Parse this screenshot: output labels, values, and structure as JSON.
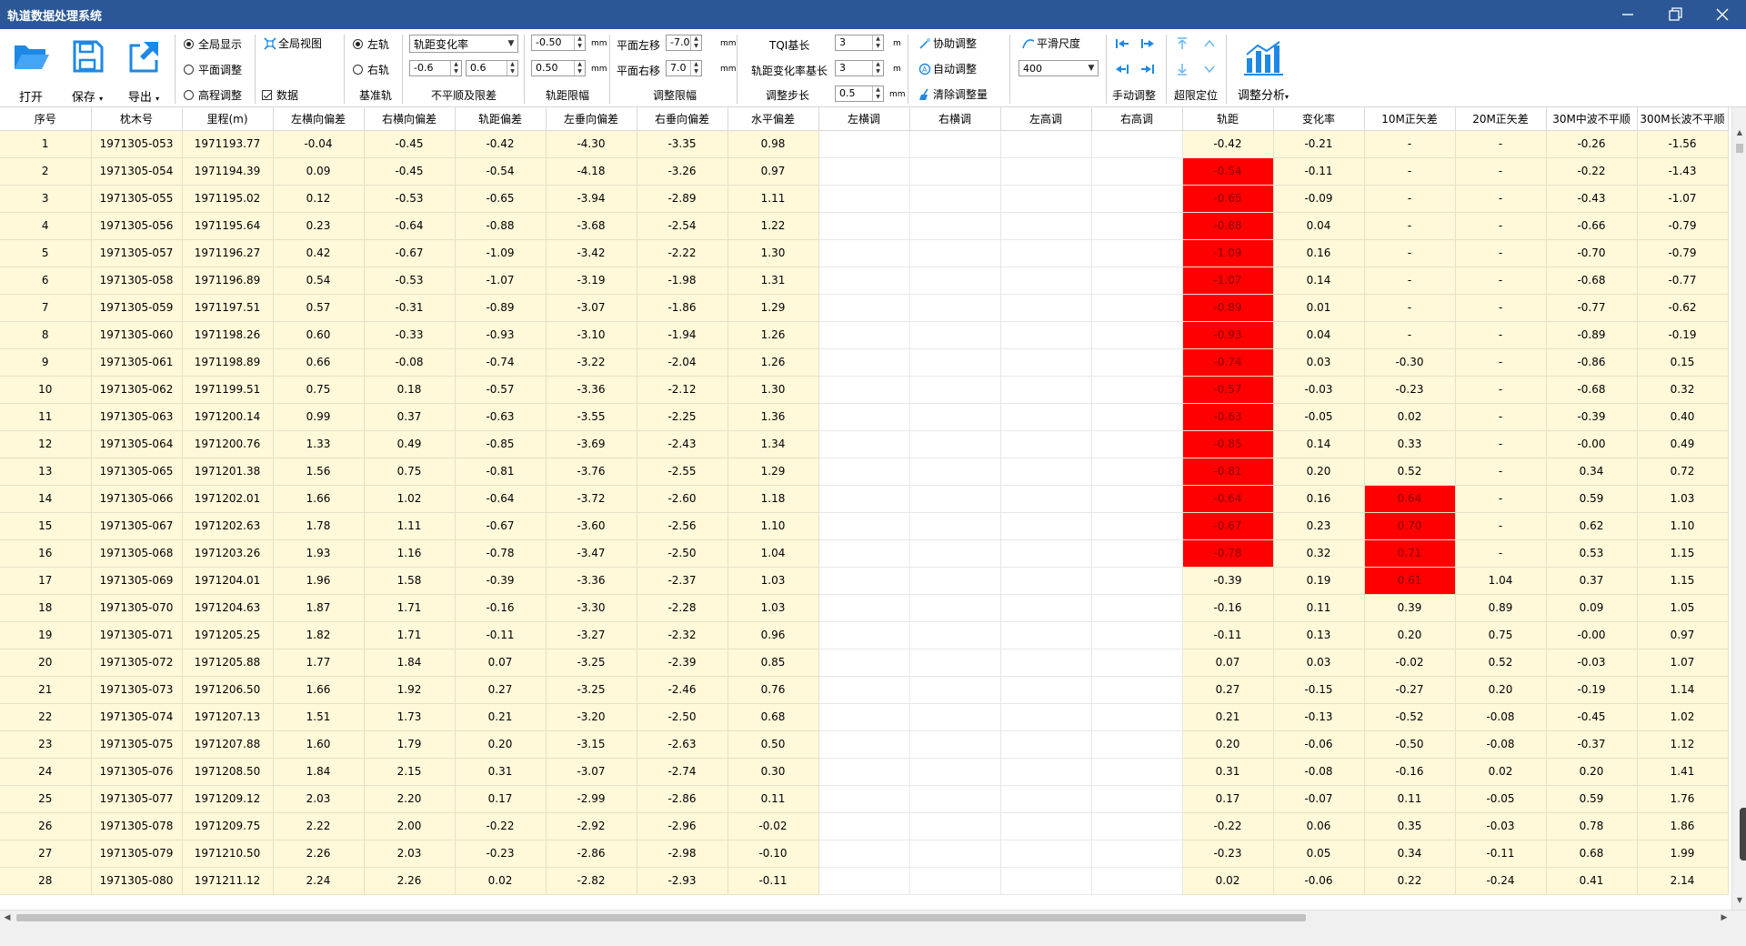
{
  "window": {
    "title": "轨道数据处理系统"
  },
  "toolbar": {
    "open_label": "打开",
    "save_label": "保存",
    "export_label": "导出",
    "display": {
      "full_display": "全局显示",
      "plane_adjust": "平面调整",
      "elevation_adjust": "高程调整",
      "global_view": "全局视图",
      "data": "数据"
    },
    "base_rail": {
      "left": "左轨",
      "right": "右轨",
      "group": "基准轨"
    },
    "unevenness": {
      "combo_value": "轨距变化率",
      "min": "-0.6",
      "max": "0.6",
      "group": "不平顺及限差"
    },
    "gauge_limit": {
      "min": "-0.50",
      "max": "0.50",
      "unit": "mm",
      "group": "轨距限幅"
    },
    "adjust_limit": {
      "left_label": "平面左移",
      "left_value": "-7.0",
      "right_label": "平面右移",
      "right_value": "7.0",
      "unit": "mm",
      "group": "调整限幅"
    },
    "tqi": {
      "base_label": "TQI基长",
      "base_value": "3",
      "base_unit": "m",
      "rate_label": "轨距变化率基长",
      "rate_value": "3",
      "rate_unit": "m",
      "step_label": "调整步长",
      "step_value": "0.5",
      "step_unit": "mm"
    },
    "assist": {
      "assist_adjust": "协助调整",
      "auto_adjust": "自动调整",
      "clear_adjust": "清除调整量"
    },
    "smooth": {
      "label": "平滑尺度",
      "value": "400"
    },
    "manual_group": "手动调整",
    "limit_group": "超限定位",
    "analysis_label": "调整分析"
  },
  "table": {
    "columns": [
      "序号",
      "枕木号",
      "里程(m)",
      "左横向偏差",
      "右横向偏差",
      "轨距偏差",
      "左垂向偏差",
      "右垂向偏差",
      "水平偏差",
      "左横调",
      "右横调",
      "左高调",
      "右高调",
      "轨距",
      "变化率",
      "10M正矢差",
      "20M正矢差",
      "30M中波不平顺",
      "300M长波不平顺"
    ],
    "rows": [
      [
        "1",
        "1971305-053",
        "1971193.77",
        "-0.04",
        "-0.45",
        "-0.42",
        "-4.30",
        "-3.35",
        "0.98",
        "",
        "",
        "",
        "",
        "-0.42",
        "-0.21",
        "-",
        "-",
        "-0.26",
        "-1.56"
      ],
      [
        "2",
        "1971305-054",
        "1971194.39",
        "0.09",
        "-0.45",
        "-0.54",
        "-4.18",
        "-3.26",
        "0.97",
        "",
        "",
        "",
        "",
        "-0.54",
        "-0.11",
        "-",
        "-",
        "-0.22",
        "-1.43"
      ],
      [
        "3",
        "1971305-055",
        "1971195.02",
        "0.12",
        "-0.53",
        "-0.65",
        "-3.94",
        "-2.89",
        "1.11",
        "",
        "",
        "",
        "",
        "-0.65",
        "-0.09",
        "-",
        "-",
        "-0.43",
        "-1.07"
      ],
      [
        "4",
        "1971305-056",
        "1971195.64",
        "0.23",
        "-0.64",
        "-0.88",
        "-3.68",
        "-2.54",
        "1.22",
        "",
        "",
        "",
        "",
        "-0.88",
        "0.04",
        "-",
        "-",
        "-0.66",
        "-0.79"
      ],
      [
        "5",
        "1971305-057",
        "1971196.27",
        "0.42",
        "-0.67",
        "-1.09",
        "-3.42",
        "-2.22",
        "1.30",
        "",
        "",
        "",
        "",
        "-1.09",
        "0.16",
        "-",
        "-",
        "-0.70",
        "-0.79"
      ],
      [
        "6",
        "1971305-058",
        "1971196.89",
        "0.54",
        "-0.53",
        "-1.07",
        "-3.19",
        "-1.98",
        "1.31",
        "",
        "",
        "",
        "",
        "-1.07",
        "0.14",
        "-",
        "-",
        "-0.68",
        "-0.77"
      ],
      [
        "7",
        "1971305-059",
        "1971197.51",
        "0.57",
        "-0.31",
        "-0.89",
        "-3.07",
        "-1.86",
        "1.29",
        "",
        "",
        "",
        "",
        "-0.89",
        "0.01",
        "-",
        "-",
        "-0.77",
        "-0.62"
      ],
      [
        "8",
        "1971305-060",
        "1971198.26",
        "0.60",
        "-0.33",
        "-0.93",
        "-3.10",
        "-1.94",
        "1.26",
        "",
        "",
        "",
        "",
        "-0.93",
        "0.04",
        "-",
        "-",
        "-0.89",
        "-0.19"
      ],
      [
        "9",
        "1971305-061",
        "1971198.89",
        "0.66",
        "-0.08",
        "-0.74",
        "-3.22",
        "-2.04",
        "1.26",
        "",
        "",
        "",
        "",
        "-0.74",
        "0.03",
        "-0.30",
        "-",
        "-0.86",
        "0.15"
      ],
      [
        "10",
        "1971305-062",
        "1971199.51",
        "0.75",
        "0.18",
        "-0.57",
        "-3.36",
        "-2.12",
        "1.30",
        "",
        "",
        "",
        "",
        "-0.57",
        "-0.03",
        "-0.23",
        "-",
        "-0.68",
        "0.32"
      ],
      [
        "11",
        "1971305-063",
        "1971200.14",
        "0.99",
        "0.37",
        "-0.63",
        "-3.55",
        "-2.25",
        "1.36",
        "",
        "",
        "",
        "",
        "-0.63",
        "-0.05",
        "0.02",
        "-",
        "-0.39",
        "0.40"
      ],
      [
        "12",
        "1971305-064",
        "1971200.76",
        "1.33",
        "0.49",
        "-0.85",
        "-3.69",
        "-2.43",
        "1.34",
        "",
        "",
        "",
        "",
        "-0.85",
        "0.14",
        "0.33",
        "-",
        "-0.00",
        "0.49"
      ],
      [
        "13",
        "1971305-065",
        "1971201.38",
        "1.56",
        "0.75",
        "-0.81",
        "-3.76",
        "-2.55",
        "1.29",
        "",
        "",
        "",
        "",
        "-0.81",
        "0.20",
        "0.52",
        "-",
        "0.34",
        "0.72"
      ],
      [
        "14",
        "1971305-066",
        "1971202.01",
        "1.66",
        "1.02",
        "-0.64",
        "-3.72",
        "-2.60",
        "1.18",
        "",
        "",
        "",
        "",
        "-0.64",
        "0.16",
        "0.64",
        "-",
        "0.59",
        "1.03"
      ],
      [
        "15",
        "1971305-067",
        "1971202.63",
        "1.78",
        "1.11",
        "-0.67",
        "-3.60",
        "-2.56",
        "1.10",
        "",
        "",
        "",
        "",
        "-0.67",
        "0.23",
        "0.70",
        "-",
        "0.62",
        "1.10"
      ],
      [
        "16",
        "1971305-068",
        "1971203.26",
        "1.93",
        "1.16",
        "-0.78",
        "-3.47",
        "-2.50",
        "1.04",
        "",
        "",
        "",
        "",
        "-0.78",
        "0.32",
        "0.71",
        "-",
        "0.53",
        "1.15"
      ],
      [
        "17",
        "1971305-069",
        "1971204.01",
        "1.96",
        "1.58",
        "-0.39",
        "-3.36",
        "-2.37",
        "1.03",
        "",
        "",
        "",
        "",
        "-0.39",
        "0.19",
        "0.61",
        "1.04",
        "0.37",
        "1.15"
      ],
      [
        "18",
        "1971305-070",
        "1971204.63",
        "1.87",
        "1.71",
        "-0.16",
        "-3.30",
        "-2.28",
        "1.03",
        "",
        "",
        "",
        "",
        "-0.16",
        "0.11",
        "0.39",
        "0.89",
        "0.09",
        "1.05"
      ],
      [
        "19",
        "1971305-071",
        "1971205.25",
        "1.82",
        "1.71",
        "-0.11",
        "-3.27",
        "-2.32",
        "0.96",
        "",
        "",
        "",
        "",
        "-0.11",
        "0.13",
        "0.20",
        "0.75",
        "-0.00",
        "0.97"
      ],
      [
        "20",
        "1971305-072",
        "1971205.88",
        "1.77",
        "1.84",
        "0.07",
        "-3.25",
        "-2.39",
        "0.85",
        "",
        "",
        "",
        "",
        "0.07",
        "0.03",
        "-0.02",
        "0.52",
        "-0.03",
        "1.07"
      ],
      [
        "21",
        "1971305-073",
        "1971206.50",
        "1.66",
        "1.92",
        "0.27",
        "-3.25",
        "-2.46",
        "0.76",
        "",
        "",
        "",
        "",
        "0.27",
        "-0.15",
        "-0.27",
        "0.20",
        "-0.19",
        "1.14"
      ],
      [
        "22",
        "1971305-074",
        "1971207.13",
        "1.51",
        "1.73",
        "0.21",
        "-3.20",
        "-2.50",
        "0.68",
        "",
        "",
        "",
        "",
        "0.21",
        "-0.13",
        "-0.52",
        "-0.08",
        "-0.45",
        "1.02"
      ],
      [
        "23",
        "1971305-075",
        "1971207.88",
        "1.60",
        "1.79",
        "0.20",
        "-3.15",
        "-2.63",
        "0.50",
        "",
        "",
        "",
        "",
        "0.20",
        "-0.06",
        "-0.50",
        "-0.08",
        "-0.37",
        "1.12"
      ],
      [
        "24",
        "1971305-076",
        "1971208.50",
        "1.84",
        "2.15",
        "0.31",
        "-3.07",
        "-2.74",
        "0.30",
        "",
        "",
        "",
        "",
        "0.31",
        "-0.08",
        "-0.16",
        "0.02",
        "0.20",
        "1.41"
      ],
      [
        "25",
        "1971305-077",
        "1971209.12",
        "2.03",
        "2.20",
        "0.17",
        "-2.99",
        "-2.86",
        "0.11",
        "",
        "",
        "",
        "",
        "0.17",
        "-0.07",
        "0.11",
        "-0.05",
        "0.59",
        "1.76"
      ],
      [
        "26",
        "1971305-078",
        "1971209.75",
        "2.22",
        "2.00",
        "-0.22",
        "-2.92",
        "-2.96",
        "-0.02",
        "",
        "",
        "",
        "",
        "-0.22",
        "0.06",
        "0.35",
        "-0.03",
        "0.78",
        "1.86"
      ],
      [
        "27",
        "1971305-079",
        "1971210.50",
        "2.26",
        "2.03",
        "-0.23",
        "-2.86",
        "-2.98",
        "-0.10",
        "",
        "",
        "",
        "",
        "-0.23",
        "0.05",
        "0.34",
        "-0.11",
        "0.68",
        "1.99"
      ],
      [
        "28",
        "1971305-080",
        "1971211.12",
        "2.24",
        "2.26",
        "0.02",
        "-2.82",
        "-2.93",
        "-0.11",
        "",
        "",
        "",
        "",
        "0.02",
        "-0.06",
        "0.22",
        "-0.24",
        "0.41",
        "2.14"
      ]
    ],
    "alerts": {
      "gauge_col": 13,
      "gauge_rows": [
        2,
        3,
        4,
        5,
        6,
        7,
        8,
        9,
        10,
        11,
        12,
        13,
        14,
        15,
        16
      ],
      "vers10_col": 15,
      "vers10_rows": [
        14,
        15,
        16,
        17
      ]
    },
    "blank_cols": [
      9,
      10,
      11,
      12
    ]
  },
  "colors": {
    "titlebar": "#2b5797",
    "row_bg": "#fff8d9",
    "alert": "#ff0000",
    "icon_blue": "#1e88e5"
  }
}
